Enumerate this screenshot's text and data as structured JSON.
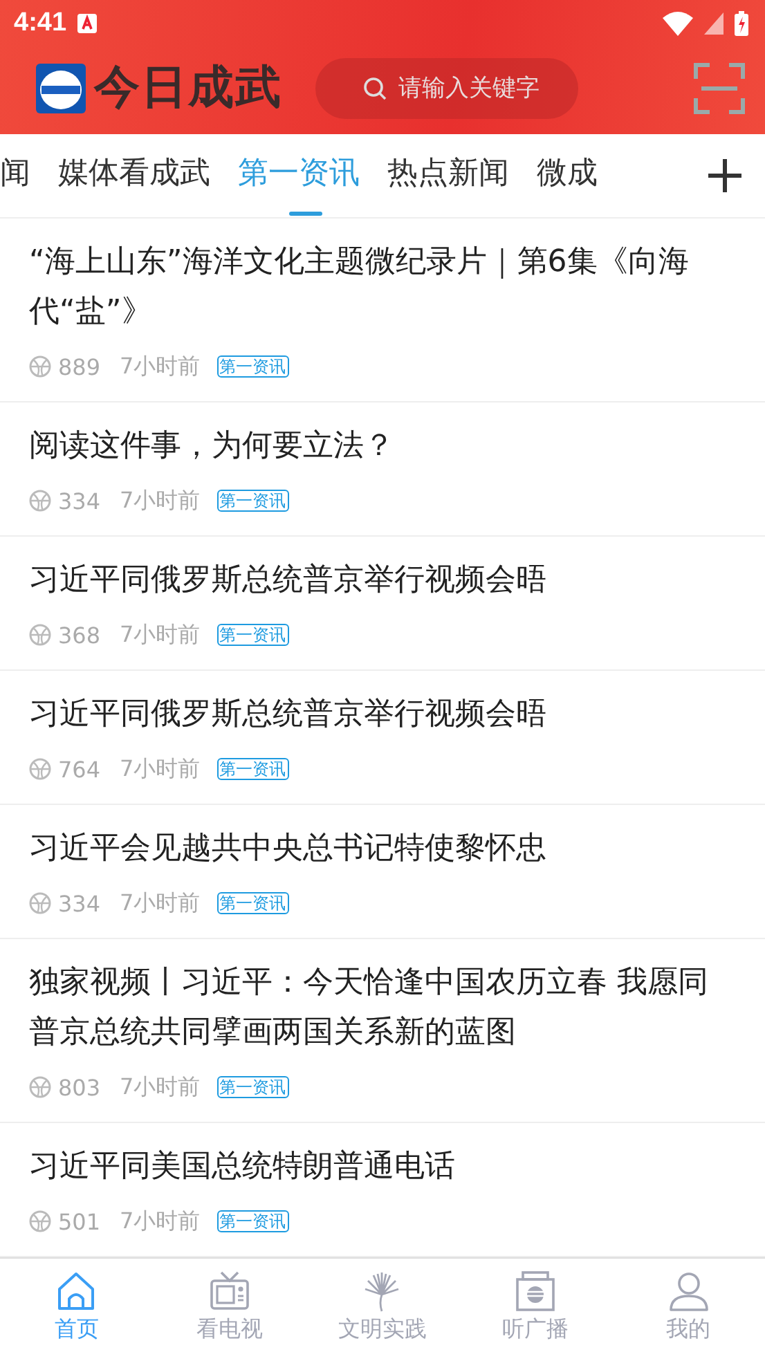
{
  "status_bar": {
    "time": "4:41"
  },
  "header": {
    "logo_text": "今日成武",
    "search": {
      "placeholder": "请输入关键字"
    }
  },
  "tabs": [
    {
      "label": "闻",
      "selected": false
    },
    {
      "label": "媒体看成武",
      "selected": false
    },
    {
      "label": "第一资讯",
      "selected": true
    },
    {
      "label": "热点新闻",
      "selected": false
    },
    {
      "label": "微成",
      "selected": false
    }
  ],
  "articles": [
    {
      "title": "“海上山东”海洋文化主题微纪录片｜第6集《向海代“盐”》",
      "views": "889",
      "time": "7小时前",
      "tag": "第一资讯"
    },
    {
      "title": "阅读这件事，为何要立法？",
      "views": "334",
      "time": "7小时前",
      "tag": "第一资讯"
    },
    {
      "title": "习近平同俄罗斯总统普京举行视频会晤",
      "views": "368",
      "time": "7小时前",
      "tag": "第一资讯"
    },
    {
      "title": "习近平同俄罗斯总统普京举行视频会晤",
      "views": "764",
      "time": "7小时前",
      "tag": "第一资讯"
    },
    {
      "title": "习近平会见越共中央总书记特使黎怀忠",
      "views": "334",
      "time": "7小时前",
      "tag": "第一资讯"
    },
    {
      "title": "独家视频丨习近平：今天恰逢中国农历立春  我愿同普京总统共同擘画两国关系新的蓝图",
      "views": "803",
      "time": "7小时前",
      "tag": "第一资讯"
    },
    {
      "title": "习近平同美国总统特朗普通电话",
      "views": "501",
      "time": "7小时前",
      "tag": "第一资讯"
    }
  ],
  "bottom_nav": [
    {
      "label": "首页",
      "kind": "home",
      "selected": true
    },
    {
      "label": "看电视",
      "kind": "tv",
      "selected": false
    },
    {
      "label": "文明实践",
      "kind": "tree",
      "selected": false
    },
    {
      "label": "听广播",
      "kind": "radio",
      "selected": false
    },
    {
      "label": "我的",
      "kind": "user",
      "selected": false
    }
  ]
}
